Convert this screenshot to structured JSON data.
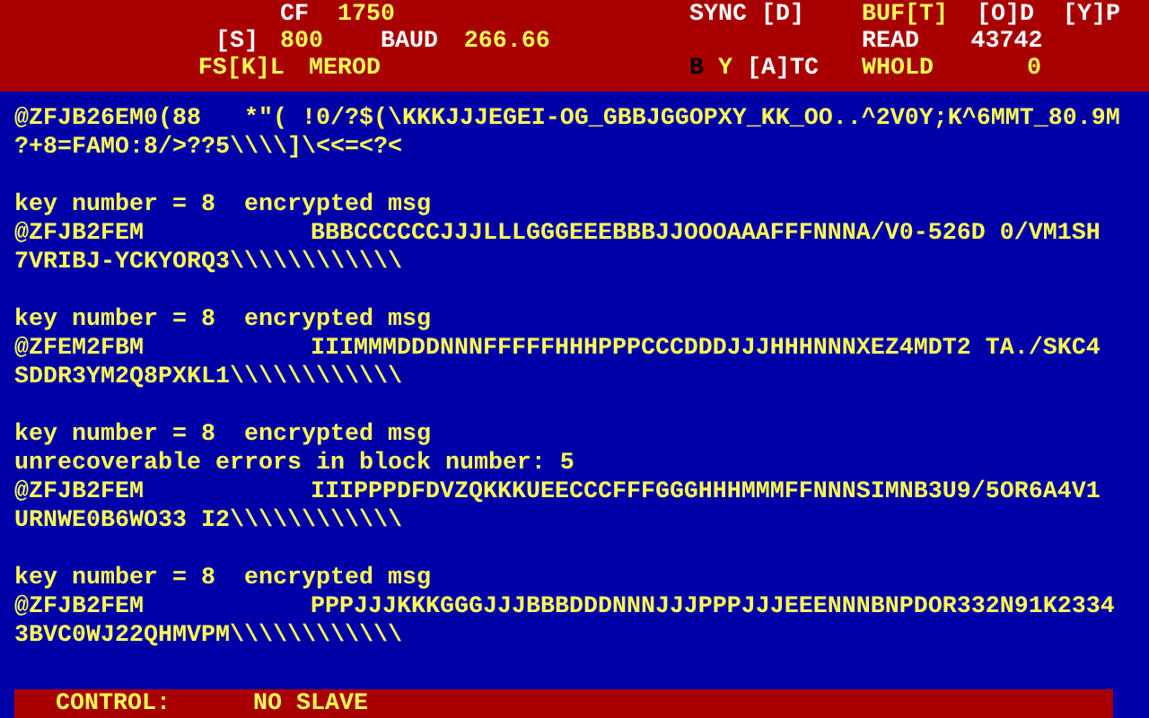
{
  "header": {
    "left": [
      [
        {
          "text": "CF",
          "color": "#fcfcfc"
        },
        {
          "text": "1750",
          "color": "#fcfc54"
        }
      ],
      [
        {
          "text": "[S]",
          "color": "#fcfcfc"
        },
        {
          "text": "800",
          "color": "#fcfc54"
        },
        {
          "text": "BAUD",
          "color": "#fcfcfc"
        },
        {
          "text": "266.66",
          "color": "#fcfc54"
        }
      ],
      [
        {
          "text": "FS[K]L",
          "color": "#fcfc54"
        },
        {
          "text": "MEROD",
          "color": "#fcfc54"
        }
      ]
    ],
    "right": [
      [
        {
          "text": "SYNC [D]",
          "color": "#fcfcfc"
        },
        {
          "text": "BUF[T]",
          "color": "#fcfc54"
        },
        {
          "text": "[O]D",
          "color": "#fcfcfc"
        },
        {
          "text": "[Y]P",
          "color": "#fcfcfc"
        }
      ],
      [
        {
          "text": "READ",
          "color": "#fcfcfc"
        },
        {
          "text": "43742",
          "color": "#fcfcfc"
        }
      ],
      [
        {
          "text": "B",
          "color": "#000000"
        },
        {
          "text": "Y",
          "color": "#fcfc54"
        },
        {
          "text": "[A]TC",
          "color": "#fcfcfc"
        },
        {
          "text": "WHOLD",
          "color": "#fcfc54"
        },
        {
          "text": "0",
          "color": "#fcfc54"
        }
      ]
    ]
  },
  "messages": [
    {
      "lines": [
        {
          "kind": "text",
          "text": "@ZFJB26EM0(88   *\"( !0/?$(\\KKKJJJEGEI-OG_GBBJGGOPXY_KK_OO..^2V0Y;K^6MMT_80.9M"
        },
        {
          "kind": "text",
          "text": "?+8=FAMO:8/>??5\\\\\\\\]\\<<=<?<"
        }
      ]
    },
    {
      "lines": [
        {
          "kind": "text",
          "text": "key number = 8  encrypted msg"
        },
        {
          "kind": "record",
          "label": "@ZFJB2FEM",
          "data": "BBBCCCCCCJJJLLLGGGEEEBBBJJOOOAAAFFFNNNA/V0-526D 0/VM1SH"
        },
        {
          "kind": "text",
          "text": "7VRIBJ-YCKYORQ3\\\\\\\\\\\\\\\\\\\\\\\\"
        }
      ]
    },
    {
      "lines": [
        {
          "kind": "text",
          "text": "key number = 8  encrypted msg"
        },
        {
          "kind": "record",
          "label": "@ZFEM2FBM",
          "data": "IIIMMMDDDNNNFFFFFHHHPPPCCCDDDJJJHHHNNNXEZ4MDT2 TA./SKC4"
        },
        {
          "kind": "text",
          "text": "SDDR3YM2Q8PXKL1\\\\\\\\\\\\\\\\\\\\\\\\"
        }
      ]
    },
    {
      "lines": [
        {
          "kind": "text",
          "text": "key number = 8  encrypted msg"
        },
        {
          "kind": "text",
          "text": "unrecoverable errors in block number: 5"
        },
        {
          "kind": "record",
          "label": "@ZFJB2FEM",
          "data": "IIIPPPDFDVZQKKKUEECCCFFFGGGHHHMMMFFNNNSIMNB3U9/5OR6A4V1"
        },
        {
          "kind": "text",
          "text": "URNWE0B6WO33 I2\\\\\\\\\\\\\\\\\\\\\\\\"
        }
      ]
    },
    {
      "lines": [
        {
          "kind": "text",
          "text": "key number = 8  encrypted msg"
        },
        {
          "kind": "record",
          "label": "@ZFJB2FEM",
          "data": "PPPJJJKKKGGGJJJBBBDDDNNNJJJPPPJJJEEENNNBNPDOR332N91K2334"
        },
        {
          "kind": "text",
          "text": "3BVC0WJ22QHMVPM\\\\\\\\\\\\\\\\\\\\\\\\"
        }
      ]
    }
  ],
  "status_bar": {
    "label": "CONTROL:",
    "value": "NO SLAVE"
  }
}
